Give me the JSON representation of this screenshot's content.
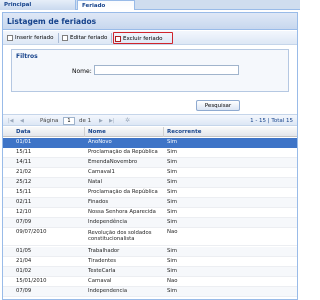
{
  "tabs": [
    {
      "label": "Principal"
    },
    {
      "label": "Feriado"
    }
  ],
  "panel": {
    "title": "Listagem de feriados"
  },
  "toolbar": {
    "inserir_label": "Inserir feriado",
    "editar_label": "Editar feriado",
    "excluir_label": "Excluir feriado"
  },
  "filtros": {
    "title": "Filtros",
    "nome_label": "Nome:",
    "nome_value": ""
  },
  "pesquisar_label": "Pesquisar",
  "pager": {
    "pagina_label": "Página",
    "page_value": "1",
    "de_label": "de 1",
    "summary": "1 - 15 | Total 15"
  },
  "grid": {
    "headers": {
      "data": "Data",
      "nome": "Nome",
      "recorrente": "Recorrente"
    },
    "rows": [
      {
        "data": "01/01",
        "nome": "AnoNovo",
        "recorrente": "Sim"
      },
      {
        "data": "15/11",
        "nome": "Proclamação da República",
        "recorrente": "Sim"
      },
      {
        "data": "14/11",
        "nome": "EmendaNovembro",
        "recorrente": "Sim"
      },
      {
        "data": "21/02",
        "nome": "Carnaval1",
        "recorrente": "Sim"
      },
      {
        "data": "25/12",
        "nome": "Natal",
        "recorrente": "Sim"
      },
      {
        "data": "15/11",
        "nome": "Proclamação da República",
        "recorrente": "Sim"
      },
      {
        "data": "02/11",
        "nome": "Finados",
        "recorrente": "Sim"
      },
      {
        "data": "12/10",
        "nome": "Nossa Senhora Aparecida",
        "recorrente": "Sim"
      },
      {
        "data": "07/09",
        "nome": "Independência",
        "recorrente": "Sim"
      },
      {
        "data": "09/07/2010",
        "nome": "Revolução dos soldados constitucionalista",
        "recorrente": "Nao"
      },
      {
        "data": "01/05",
        "nome": "Trabalhador",
        "recorrente": "Sim"
      },
      {
        "data": "21/04",
        "nome": "Tiradentes",
        "recorrente": "Sim"
      },
      {
        "data": "01/02",
        "nome": "TesteCarla",
        "recorrente": "Sim"
      },
      {
        "data": "15/01/2010",
        "nome": "Carnaval",
        "recorrente": "Nao"
      },
      {
        "data": "07/09",
        "nome": "Independencia",
        "recorrente": "Sim"
      }
    ]
  },
  "colors": {
    "selected_row": "#3e74c7",
    "header_text": "#15428b",
    "highlight_box": "#d0242c"
  }
}
